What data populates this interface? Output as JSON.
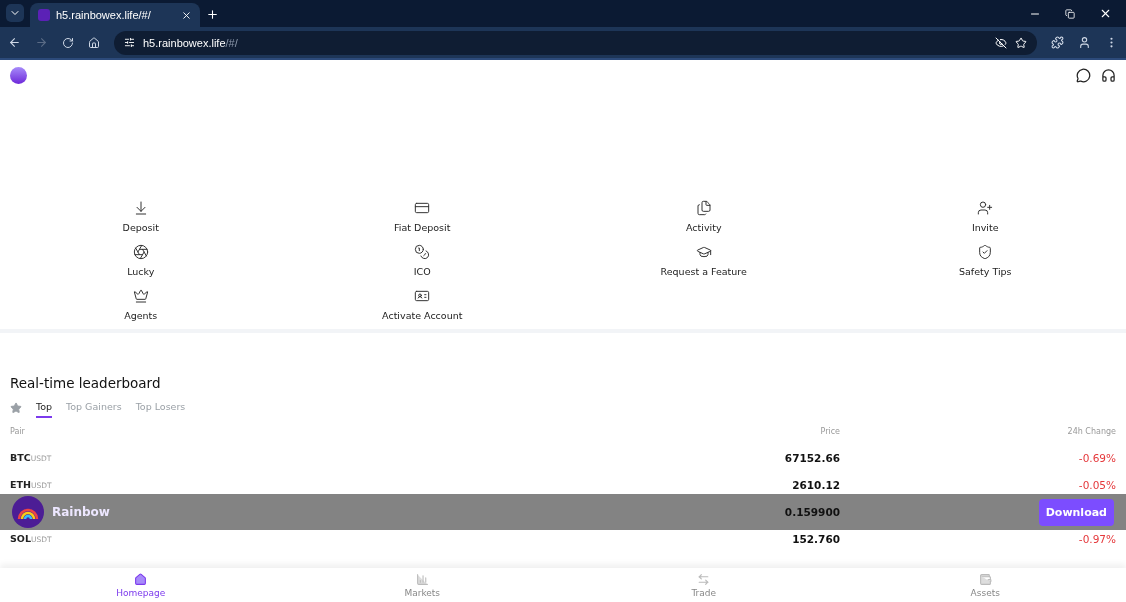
{
  "browser": {
    "tab_title": "h5.rainbowex.life/#/",
    "url_host": "h5.rainbowex.life",
    "url_path": "/#/"
  },
  "shortcuts": [
    {
      "label": "Deposit",
      "kind": "deposit"
    },
    {
      "label": "Fiat Deposit",
      "kind": "fiat"
    },
    {
      "label": "Activity",
      "kind": "activity"
    },
    {
      "label": "Invite",
      "kind": "invite"
    },
    {
      "label": "Lucky",
      "kind": "lucky"
    },
    {
      "label": "ICO",
      "kind": "ico"
    },
    {
      "label": "Request a Feature",
      "kind": "request"
    },
    {
      "label": "Safety Tips",
      "kind": "safety"
    },
    {
      "label": "Agents",
      "kind": "agents"
    },
    {
      "label": "Activate Account",
      "kind": "activate"
    }
  ],
  "leaderboard": {
    "title": "Real-time leaderboard",
    "tabs": [
      {
        "label": "Top",
        "selected": true
      },
      {
        "label": "Top Gainers",
        "selected": false
      },
      {
        "label": "Top Losers",
        "selected": false
      }
    ],
    "columns": [
      "Pair",
      "Price",
      "24h Change"
    ],
    "rows": [
      {
        "base": "BTC",
        "quote": "USDT",
        "price": "67152.66",
        "change": "-0.69%",
        "color": "#e5383b"
      },
      {
        "base": "ETH",
        "quote": "USDT",
        "price": "2610.12",
        "change": "-0.05%",
        "color": "#e5383b"
      },
      {
        "base": "",
        "quote": "",
        "price": "0.159900",
        "change": ""
      },
      {
        "base": "SOL",
        "quote": "USDT",
        "price": "152.760",
        "change": "-0.97%",
        "color": "#e5383b"
      }
    ]
  },
  "banner": {
    "name": "Rainbow",
    "button": "Download"
  },
  "nav": [
    {
      "label": "Homepage",
      "selected": true,
      "kind": "home"
    },
    {
      "label": "Markets",
      "selected": false,
      "kind": "markets"
    },
    {
      "label": "Trade",
      "selected": false,
      "kind": "trade"
    },
    {
      "label": "Assets",
      "selected": false,
      "kind": "assets"
    }
  ]
}
